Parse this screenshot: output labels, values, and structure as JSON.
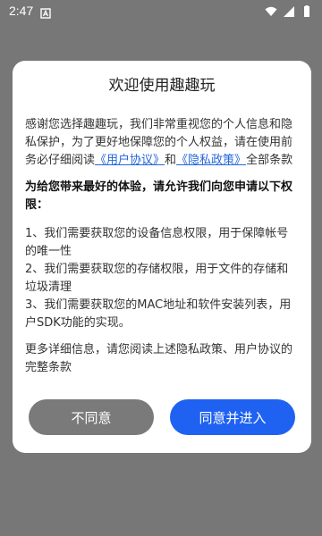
{
  "status_bar": {
    "time": "2:47",
    "icons": [
      "notification-a-icon",
      "wifi-icon",
      "signal-icon",
      "battery-icon"
    ],
    "color": "#ffffff"
  },
  "dialog": {
    "title": "欢迎使用趣趣玩",
    "intro_before_link": "感谢您选择趣趣玩，我们非常重视您的个人信息和隐私保护，为了更好地保障您的个人权益，请在使用前务必仔细阅读",
    "user_agreement_link": "《用户协议》",
    "and_text": "和",
    "privacy_policy_link": "《隐私政策》",
    "intro_after_link": "全部条款",
    "permission_intro": "为给您带来最好的体验，请允许我们向您申请以下权限：",
    "permissions": [
      "1、我们需要获取您的设备信息权限，用于保障帐号的唯一性",
      "2、我们需要获取您的存储权限，用于文件的存储和垃圾清理",
      "3、我们需要获取您的MAC地址和软件安装列表，用户SDK功能的实现。"
    ],
    "more_info": "更多详细信息，请您阅读上述隐私政策、用户协议的完整条款",
    "decline_label": "不同意",
    "accept_label": "同意并进入"
  },
  "colors": {
    "backdrop": "#777777",
    "link": "#2266dd",
    "accept_button": "#1f62f2",
    "decline_button": "#7a7a7a"
  }
}
